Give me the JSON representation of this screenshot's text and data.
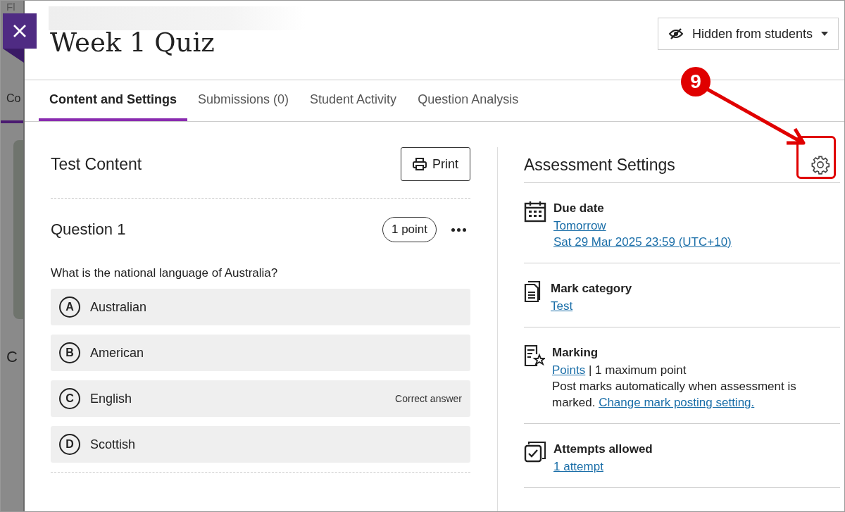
{
  "background": {
    "fragments": [
      "Fl",
      "Co",
      "C"
    ]
  },
  "header": {
    "title": "Week 1 Quiz",
    "visibility": "Hidden from students"
  },
  "tabs": [
    {
      "label": "Content and Settings",
      "selected": true
    },
    {
      "label": "Submissions (0)",
      "selected": false
    },
    {
      "label": "Student Activity",
      "selected": false
    },
    {
      "label": "Question Analysis",
      "selected": false
    }
  ],
  "content": {
    "title": "Test Content",
    "print": "Print",
    "question": {
      "title": "Question 1",
      "points": "1 point",
      "text": "What is the national language of Australia?",
      "options": [
        {
          "letter": "A",
          "text": "Australian",
          "correct": false
        },
        {
          "letter": "B",
          "text": "American",
          "correct": false
        },
        {
          "letter": "C",
          "text": "English",
          "correct": true,
          "note": "Correct answer"
        },
        {
          "letter": "D",
          "text": "Scottish",
          "correct": false
        }
      ]
    }
  },
  "settings": {
    "title": "Assessment Settings",
    "items": [
      {
        "kind": "calendar",
        "title": "Due date",
        "lines": [
          [
            {
              "text": "Tomorrow",
              "link": true
            }
          ],
          [
            {
              "text": "Sat 29 Mar 2025 23:59 (UTC+10)",
              "link": true
            }
          ]
        ]
      },
      {
        "kind": "document",
        "title": "Mark category",
        "lines": [
          [
            {
              "text": "Test",
              "link": true
            }
          ]
        ]
      },
      {
        "kind": "marking",
        "title": "Marking",
        "lines": [
          [
            {
              "text": "Points",
              "link": true
            },
            {
              "text": " | 1 maximum point",
              "link": false
            }
          ],
          [
            {
              "text": "Post marks automatically when assessment is marked. ",
              "link": false
            },
            {
              "text": "Change mark posting setting.",
              "link": true
            }
          ]
        ]
      },
      {
        "kind": "attempts",
        "title": "Attempts allowed",
        "lines": [
          [
            {
              "text": "1 attempt",
              "link": true
            }
          ]
        ]
      }
    ]
  },
  "annotation": {
    "number": "9"
  }
}
